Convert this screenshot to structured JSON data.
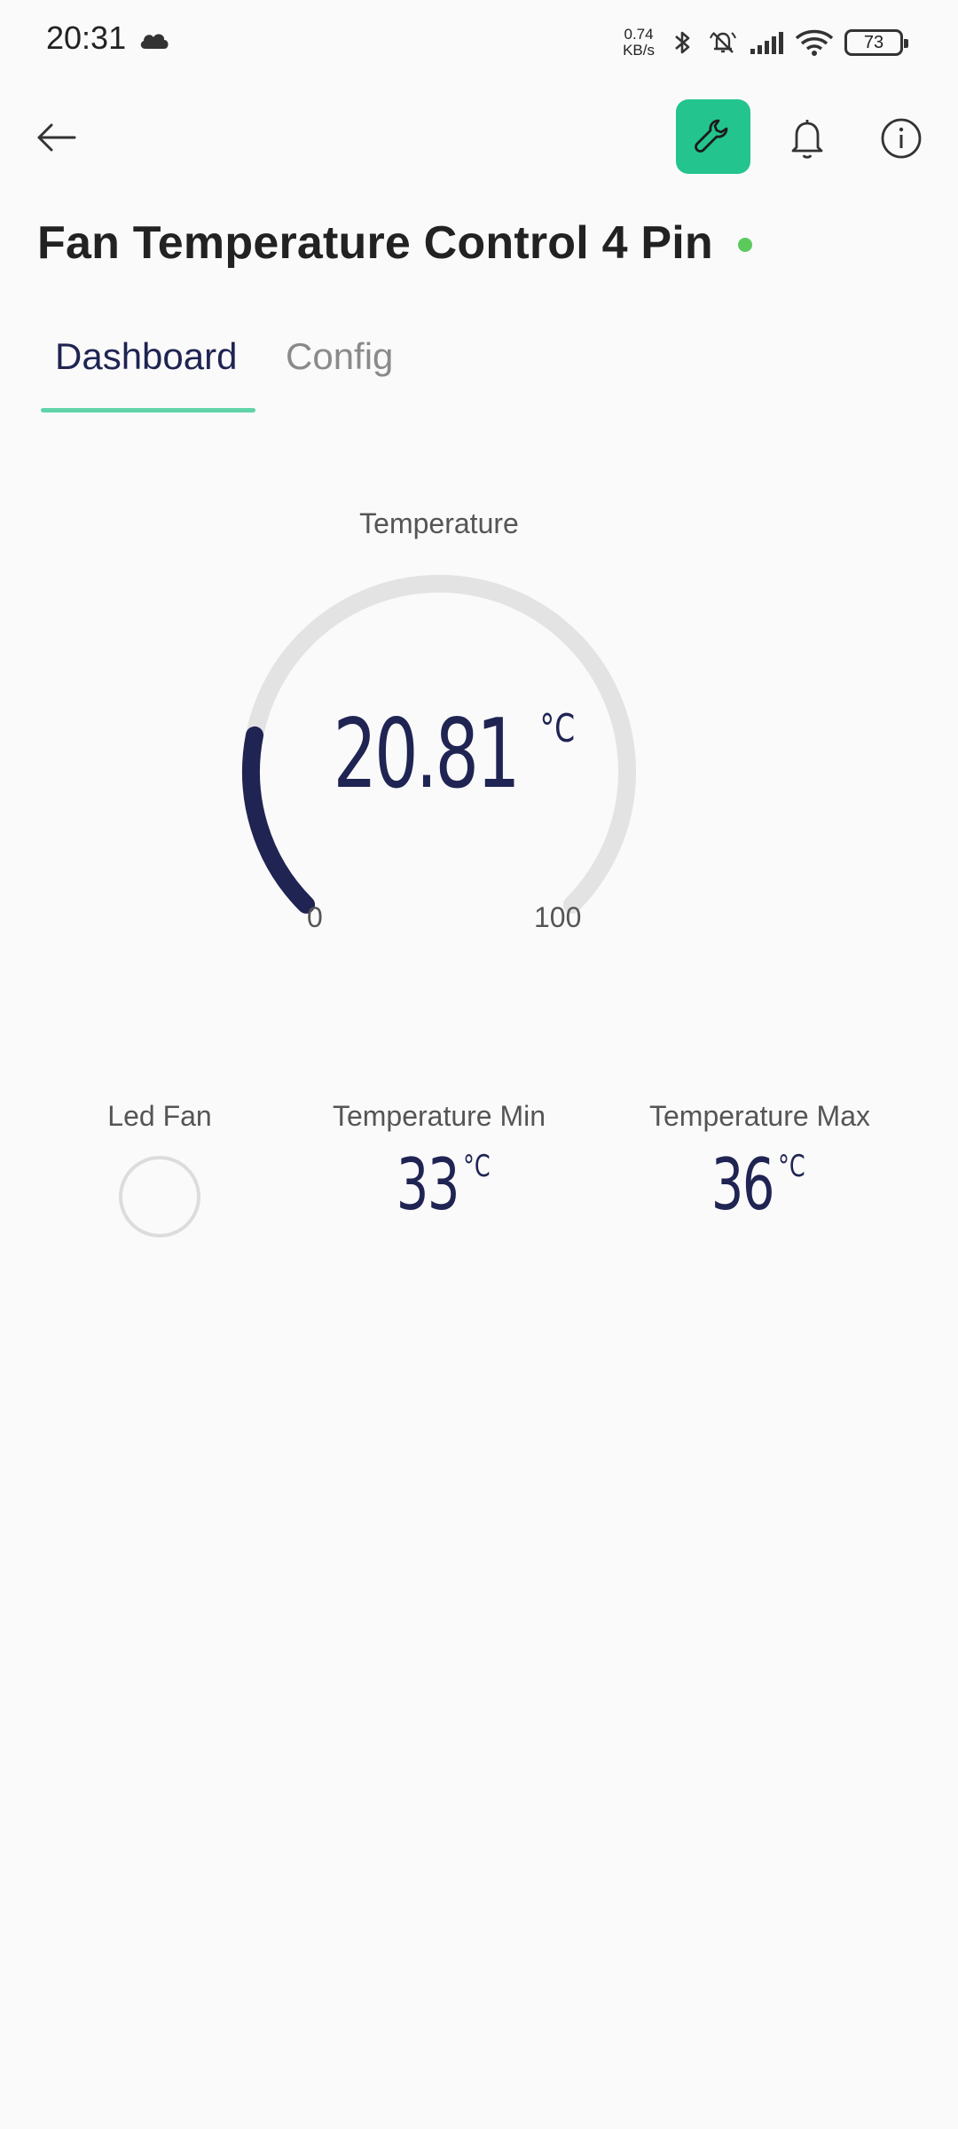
{
  "status_bar": {
    "time": "20:31",
    "netspeed_value": "0.74",
    "netspeed_unit": "KB/s",
    "battery": "73",
    "icons": [
      "cloud-icon",
      "bluetooth-icon",
      "mute-icon",
      "signal-icon",
      "wifi-icon",
      "battery-icon"
    ]
  },
  "toolbar": {
    "back_icon": "arrow-left-icon",
    "wrench_icon": "wrench-icon",
    "bell_icon": "bell-icon",
    "info_icon": "info-icon",
    "accent": "#23c48e"
  },
  "device": {
    "title": "Fan Temperature Control 4 Pin",
    "online_color": "#5cc95c"
  },
  "tabs": [
    {
      "label": "Dashboard",
      "active": true
    },
    {
      "label": "Config",
      "active": false
    }
  ],
  "gauge": {
    "label": "Temperature",
    "value": "20.81",
    "unit": "°C",
    "min": "0",
    "max": "100",
    "fraction": 0.2081,
    "color": "#1f2453",
    "track_color": "#e3e3e3"
  },
  "widgets": {
    "led_fan": {
      "label": "Led Fan"
    },
    "temp_min": {
      "label": "Temperature Min",
      "value": "33",
      "unit": "°C"
    },
    "temp_max": {
      "label": "Temperature Max",
      "value": "36",
      "unit": "°C"
    }
  }
}
